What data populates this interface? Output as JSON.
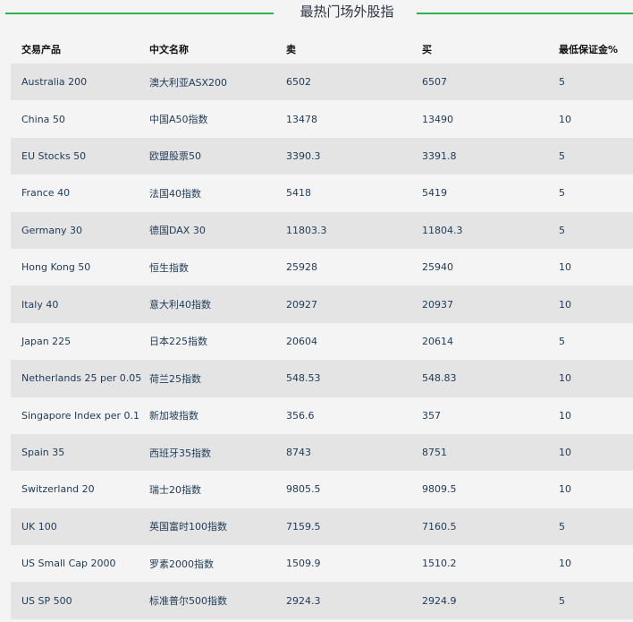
{
  "title": "最热门场外股指",
  "colors": {
    "accent_line": "#2eb34a",
    "row_stripe": "#e4e4e4",
    "row_plain": "#f4f4f4"
  },
  "columns": [
    "交易产品",
    "中文名称",
    "卖",
    "买",
    "最低保证金%"
  ],
  "rows": [
    [
      "Australia 200",
      "澳大利亚ASX200",
      "6502",
      "6507",
      "5"
    ],
    [
      "China 50",
      "中国A50指数",
      "13478",
      "13490",
      "10"
    ],
    [
      "EU Stocks 50",
      "欧盟股票50",
      "3390.3",
      "3391.8",
      "5"
    ],
    [
      "France 40",
      "法国40指数",
      "5418",
      "5419",
      "5"
    ],
    [
      "Germany 30",
      "德国DAX 30",
      "11803.3",
      "11804.3",
      "5"
    ],
    [
      "Hong Kong 50",
      "恒生指数",
      "25928",
      "25940",
      "10"
    ],
    [
      "Italy 40",
      "意大利40指数",
      "20927",
      "20937",
      "10"
    ],
    [
      "Japan 225",
      "日本225指数",
      "20604",
      "20614",
      "5"
    ],
    [
      "Netherlands 25 per 0.05",
      "荷兰25指数",
      "548.53",
      "548.83",
      "10"
    ],
    [
      "Singapore Index per 0.1",
      "新加坡指数",
      "356.6",
      "357",
      "10"
    ],
    [
      "Spain 35",
      "西班牙35指数",
      "8743",
      "8751",
      "10"
    ],
    [
      "Switzerland 20",
      "瑞士20指数",
      "9805.5",
      "9809.5",
      "10"
    ],
    [
      "UK 100",
      "英国富时100指数",
      "7159.5",
      "7160.5",
      "5"
    ],
    [
      "US Small Cap 2000",
      "罗素2000指数",
      "1509.9",
      "1510.2",
      "10"
    ],
    [
      "US SP 500",
      "标准普尔500指数",
      "2924.3",
      "2924.9",
      "5"
    ]
  ]
}
